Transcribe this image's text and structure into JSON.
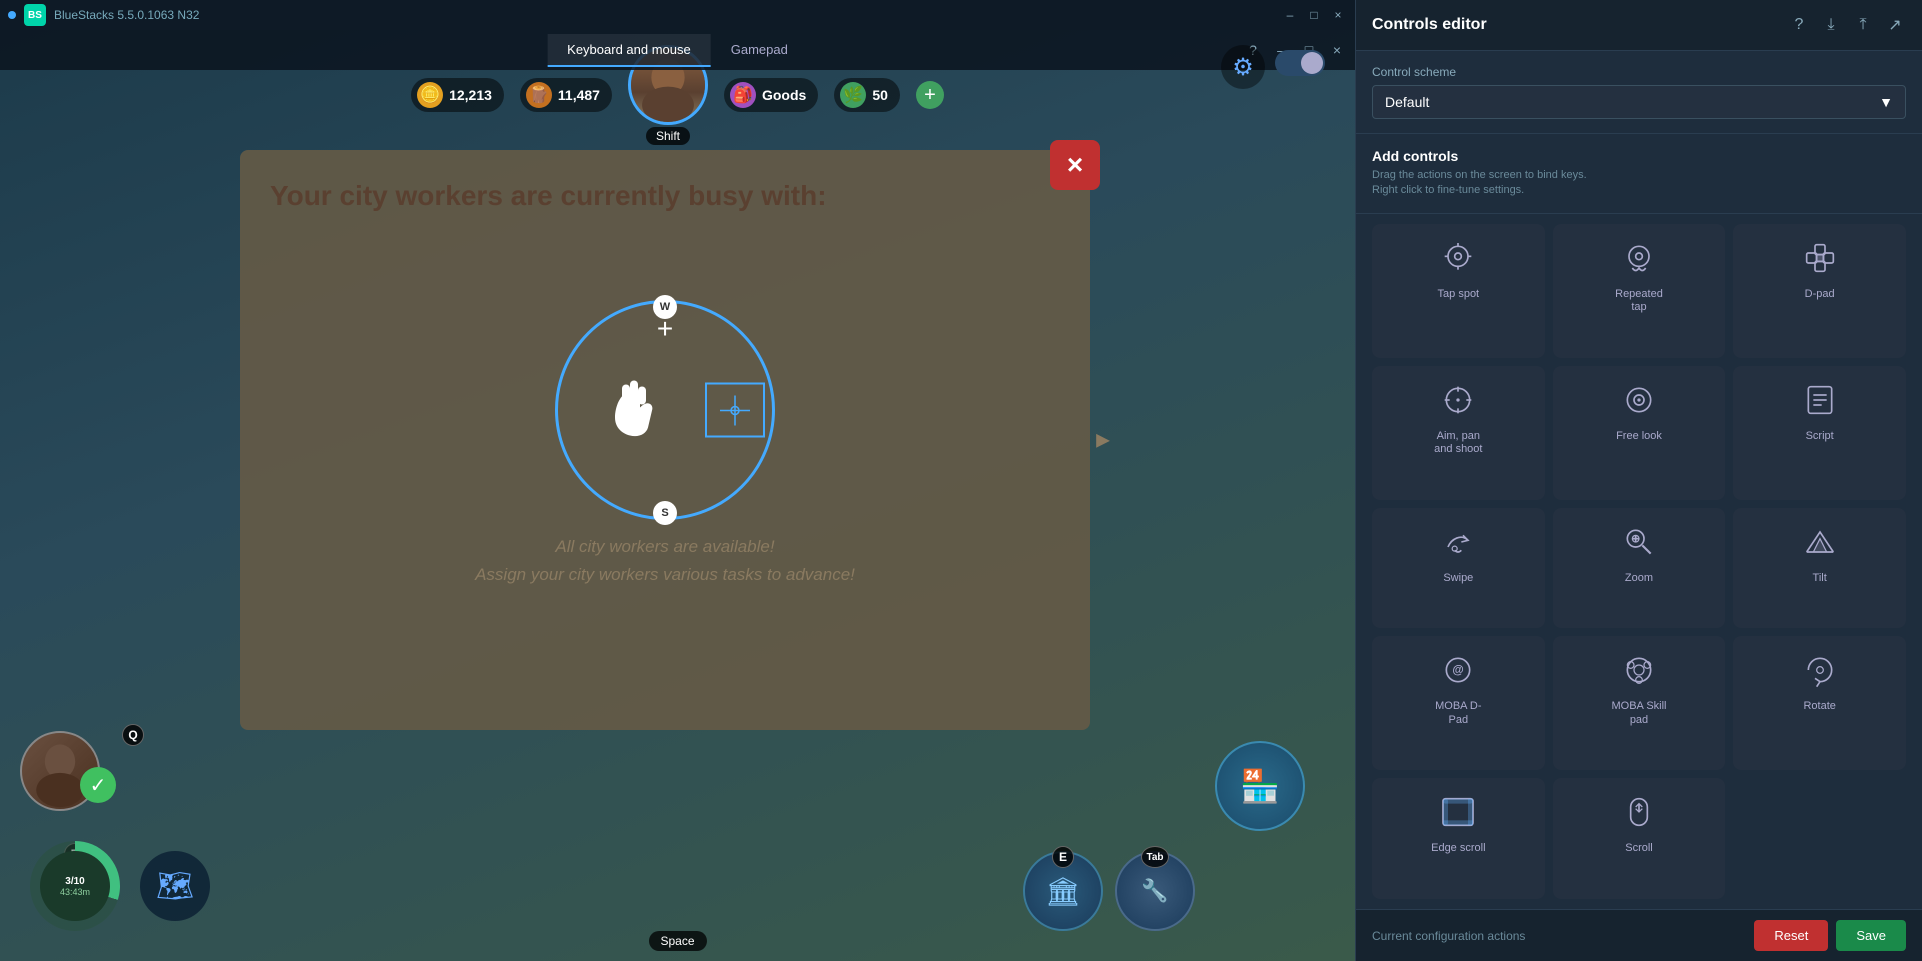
{
  "app": {
    "title": "BlueStacks 5.5.0.1063 N32",
    "version": "5.5.0.1063 N32"
  },
  "top_bar": {
    "tabs": [
      {
        "id": "keyboard",
        "label": "Keyboard and mouse",
        "active": true
      },
      {
        "id": "gamepad",
        "label": "Gamepad",
        "active": false
      }
    ],
    "window_controls": [
      "–",
      "□",
      "×"
    ]
  },
  "resources": {
    "gold": {
      "value": "12,213",
      "icon": "🪙"
    },
    "wood": {
      "value": "11,487",
      "icon": "🪵"
    },
    "goods": {
      "label": "Goods",
      "icon": "🎒"
    },
    "green": {
      "value": "50",
      "icon": "🌿"
    },
    "add_icon": "+"
  },
  "avatar": {
    "shift_label": "Shift"
  },
  "modal": {
    "title": "Your city workers are currently busy with:",
    "text1": "All city workers are available!",
    "text2": "Assign your city workers various tasks to advance!",
    "close_label": "×",
    "wasd_w": "W",
    "wasd_s": "S"
  },
  "controls_editor": {
    "title": "Controls editor",
    "scheme_label": "Control scheme",
    "scheme_value": "Default",
    "add_controls_title": "Add controls",
    "add_controls_desc": "Drag the actions on the screen to bind keys.\nRight click to fine-tune settings.",
    "controls": [
      {
        "id": "tap_spot",
        "label": "Tap spot",
        "icon": "tap_spot"
      },
      {
        "id": "repeated_tap",
        "label": "Repeated\ntap",
        "icon": "repeated_tap"
      },
      {
        "id": "d_pad",
        "label": "D-pad",
        "icon": "d_pad"
      },
      {
        "id": "aim_pan_shoot",
        "label": "Aim, pan\nand shoot",
        "icon": "aim_pan"
      },
      {
        "id": "free_look",
        "label": "Free look",
        "icon": "free_look"
      },
      {
        "id": "script",
        "label": "Script",
        "icon": "script"
      },
      {
        "id": "swipe",
        "label": "Swipe",
        "icon": "swipe"
      },
      {
        "id": "zoom",
        "label": "Zoom",
        "icon": "zoom"
      },
      {
        "id": "tilt",
        "label": "Tilt",
        "icon": "tilt"
      },
      {
        "id": "moba_d_pad",
        "label": "MOBA D-\nPad",
        "icon": "moba_d"
      },
      {
        "id": "moba_skill_pad",
        "label": "MOBA Skill\npad",
        "icon": "moba_skill"
      },
      {
        "id": "rotate",
        "label": "Rotate",
        "icon": "rotate"
      },
      {
        "id": "edge_scroll",
        "label": "Edge scroll",
        "icon": "edge_scroll"
      },
      {
        "id": "scroll",
        "label": "Scroll",
        "icon": "scroll"
      }
    ],
    "bottom": {
      "current_config_label": "Current configuration actions",
      "reset_label": "Reset",
      "save_label": "Save"
    }
  },
  "game": {
    "timer": {
      "fraction": "3/10",
      "time": "43:43m"
    },
    "key_badges": {
      "q": "Q",
      "r": "R",
      "e": "E",
      "tab": "Tab",
      "space": "Space"
    }
  }
}
